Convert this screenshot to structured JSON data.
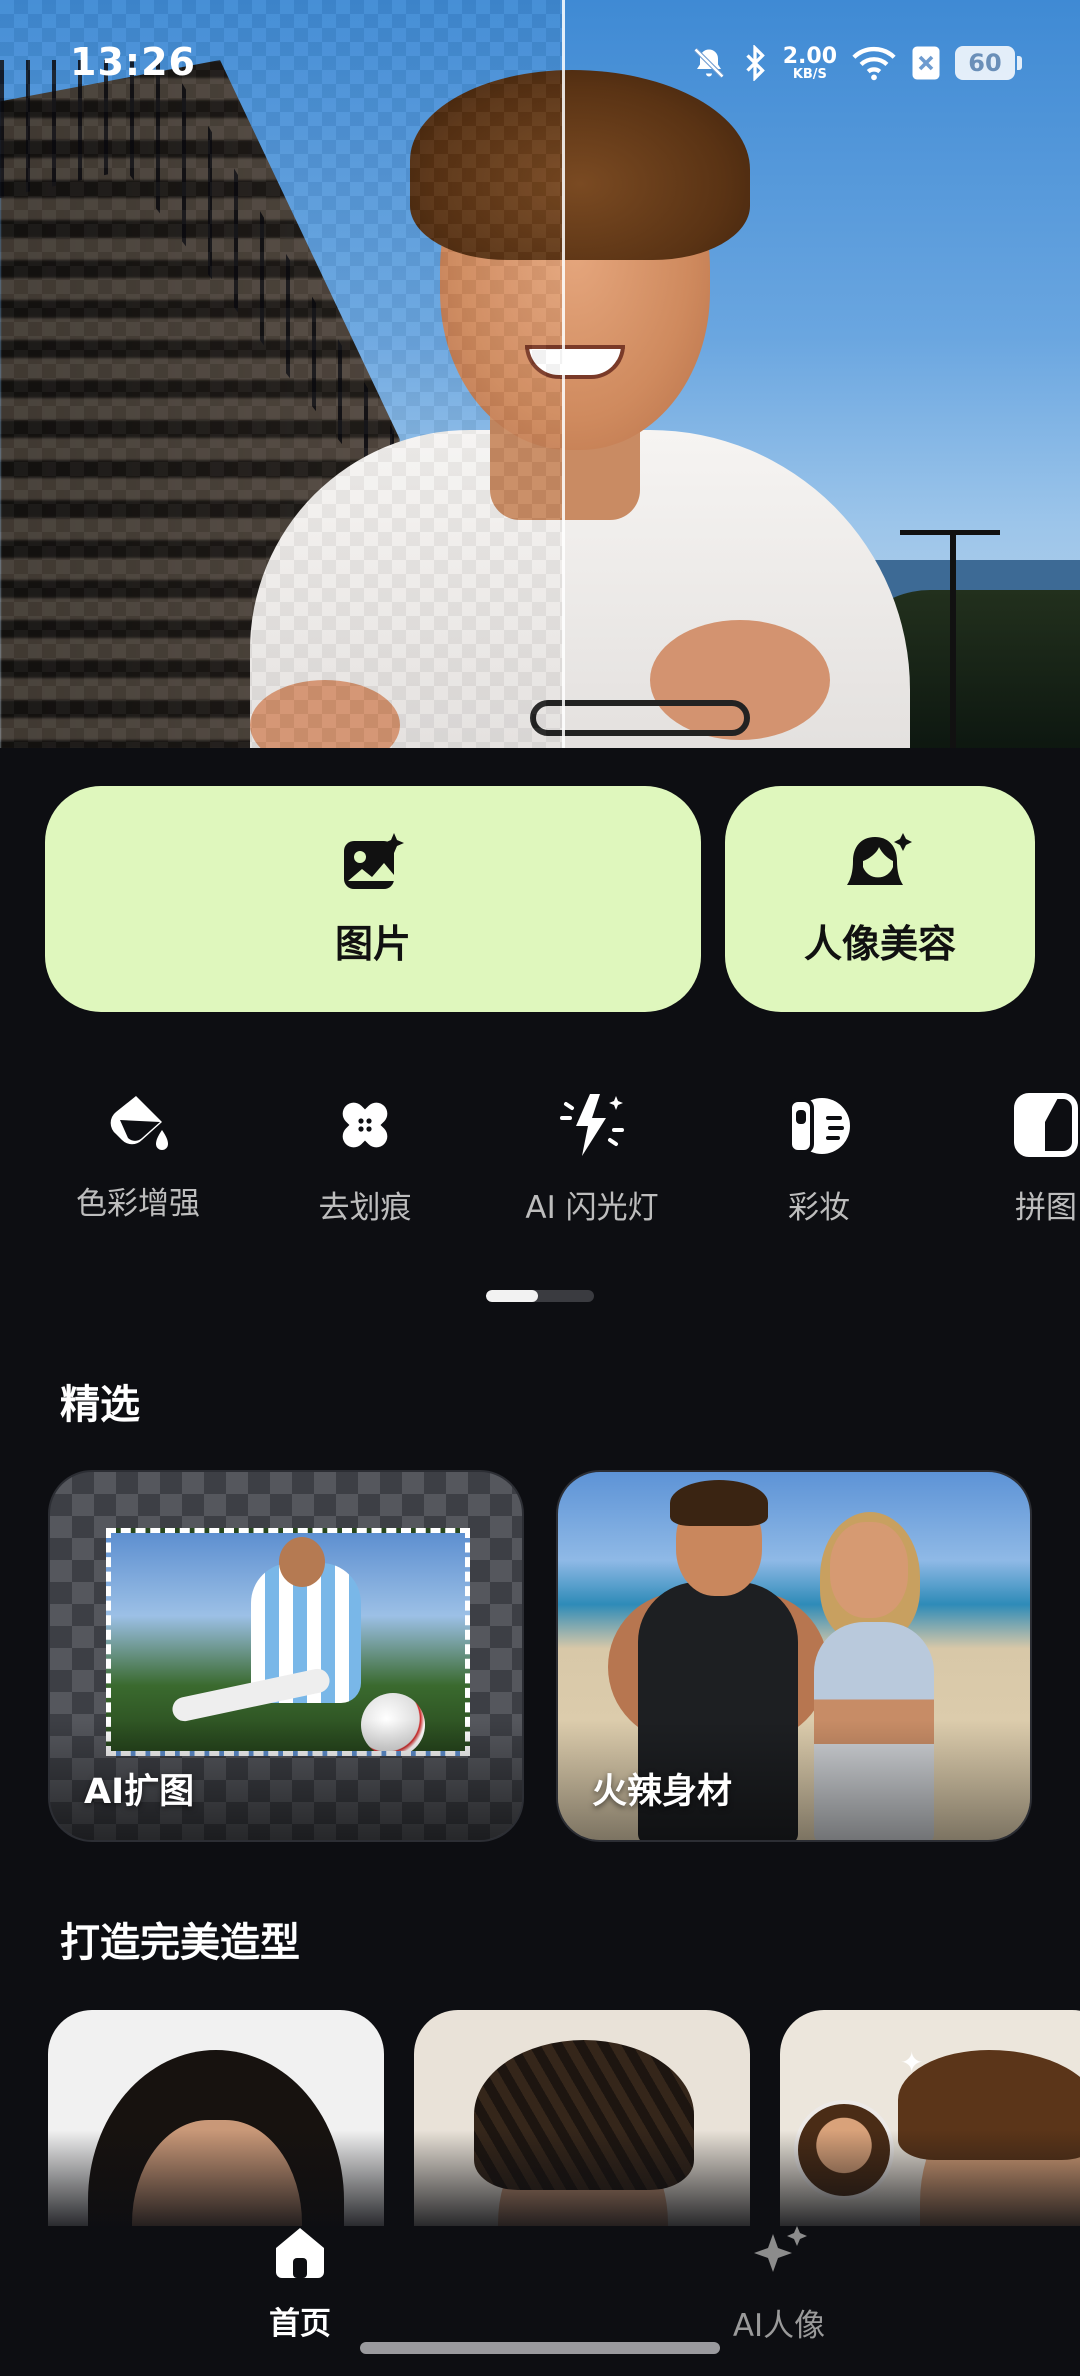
{
  "status_bar": {
    "time": "13:26",
    "net_speed_value": "2.00",
    "net_speed_unit": "KB/S",
    "battery": "60",
    "icons": [
      "bell-off-icon",
      "bluetooth-icon",
      "wifi-icon",
      "sim-off-icon",
      "battery-icon"
    ]
  },
  "primary_actions": [
    {
      "label": "图片",
      "icon": "image-sparkle-icon"
    },
    {
      "label": "人像美容",
      "icon": "portrait-sparkle-icon"
    }
  ],
  "tools": [
    {
      "label": "色彩增强",
      "icon": "color-bucket-icon"
    },
    {
      "label": "去划痕",
      "icon": "bandage-icon"
    },
    {
      "label": "AI 闪光灯",
      "icon": "flash-sparkle-icon"
    },
    {
      "label": "彩妆",
      "icon": "makeup-palette-icon"
    },
    {
      "label": "拼图",
      "icon": "collage-icon"
    }
  ],
  "featured": {
    "title": "精选",
    "cards": [
      {
        "caption": "AI扩图"
      },
      {
        "caption": "火辣身材"
      }
    ]
  },
  "styles": {
    "title": "打造完美造型"
  },
  "bottom_nav": [
    {
      "label": "首页",
      "icon": "home-icon",
      "active": true
    },
    {
      "label": "AI人像",
      "icon": "sparkle-icon",
      "active": false
    }
  ],
  "colors": {
    "background": "#0d0e12",
    "accent_button": "#dff7bd"
  }
}
